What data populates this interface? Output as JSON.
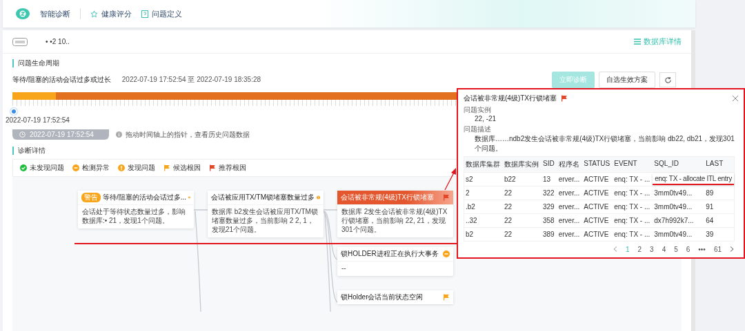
{
  "nav": {
    "logo_text": "智能诊断",
    "links": [
      {
        "label": "健康评分",
        "kind": "star"
      },
      {
        "label": "问题定义",
        "kind": "doc"
      }
    ]
  },
  "header": {
    "instance": "•  •2  10..",
    "detail_link": "数据库详情"
  },
  "lifecycle": {
    "title": "问题生命周期",
    "problem": "等待/阻塞的活动会话过多或过长",
    "range": "2022-07-19 17:52:54 至 2022-07-19 18:35:28",
    "buttons": [
      {
        "label": "立即诊断",
        "kind": "primary",
        "disabled": true
      },
      {
        "label": "自选生效方案",
        "kind": "default",
        "disabled": false
      }
    ],
    "segments": [
      {
        "color": "#f8a51c",
        "level": 0.065
      },
      {
        "color": "#e2701f",
        "level": 0.935
      }
    ],
    "pointer_label": "2022-07-19 17:52:54",
    "time_chip": "2022-07-19 17:52:54",
    "hint": "拖动时间轴上的指针，查看历史问题数据"
  },
  "diagnosis": {
    "title": "诊断详情",
    "legend": [
      {
        "label": "未发现问题",
        "kind": "ok"
      },
      {
        "label": "检测异常",
        "kind": "anomaly"
      },
      {
        "label": "发现问题",
        "kind": "problem"
      },
      {
        "label": "候选根因",
        "kind": "candidate"
      },
      {
        "label": "推荐根因",
        "kind": "recommended"
      }
    ],
    "nodes": [
      {
        "tag": "警告",
        "title": "等待/阻塞的活动会话过多...",
        "kind": "problem",
        "highlighted": false,
        "body": "会话处于等待状态数量过多，影响数据库:•      21，发现1个问题。"
      },
      {
        "title": "会话被应用TX/TM锁堵塞数量过多",
        "kind": "problem",
        "highlighted": false,
        "body": "数据库   b2发生会话被应用TX/TM锁堵塞数量过多，当前影响  2 2,      1，发现21个问题。"
      },
      {
        "title": "会话被非常规(4级)TX行锁堵塞",
        "kind": "recommended",
        "highlighted": true,
        "body": "数据库   2发生会话被非常规(4级)TX行锁堵塞，当前影响   22,   21，发现301个问题。"
      },
      {
        "title": "锁HOLDER进程正在执行大事务",
        "kind": "anomaly",
        "highlighted": false,
        "body": "--"
      },
      {
        "title": "锁Holder会话当前状态空闲",
        "kind": "candidate",
        "highlighted": false
      }
    ]
  },
  "popup": {
    "title": "会话被非常规(4级)TX行锁堵塞",
    "fields": [
      {
        "label": "问题实例",
        "value": "22,    -21"
      },
      {
        "label": "问题描述",
        "value": "数据库……ndb2发生会话被非常规(4级)TX行锁堵塞，当前影响  db22,  db21，发现301个问题。"
      }
    ],
    "columns": [
      "数据库集群",
      "数据库实例",
      "SID",
      "程序名",
      "STATUS",
      "EVENT",
      "SQL_ID",
      "LAST"
    ],
    "rows": [
      [
        "s2",
        "b22",
        "13",
        "erver...",
        "ACTIVE",
        "enq: TX - ..."
      ],
      [
        "2",
        "22",
        "322",
        "erver...",
        "ACTIVE",
        "enq: TX - ...",
        "3mm0tv49...",
        "89"
      ],
      [
        ".b2",
        "22",
        "329",
        "erver...",
        "ACTIVE",
        "enq: TX - ...",
        "3mm0tv49...",
        "91"
      ],
      [
        "..32",
        "22",
        "358",
        "erver...",
        "ACTIVE",
        "enq: TX - ...",
        "dx7h992k7...",
        "64"
      ],
      [
        "b2",
        "22",
        "389",
        "erver...",
        "ACTIVE",
        "enq: TX - ...",
        "3mm0tv49...",
        "39"
      ]
    ],
    "tooltip": "enq: TX - allocate ITL entry",
    "pages": [
      {
        "label": "1",
        "selected": true
      },
      {
        "label": "2",
        "selected": false
      },
      {
        "label": "3",
        "selected": false
      },
      {
        "label": "4",
        "selected": false
      },
      {
        "label": "5",
        "selected": false
      },
      {
        "label": "6",
        "selected": false
      },
      {
        "label": "•••",
        "selected": false
      },
      {
        "label": "61",
        "selected": false
      }
    ]
  }
}
